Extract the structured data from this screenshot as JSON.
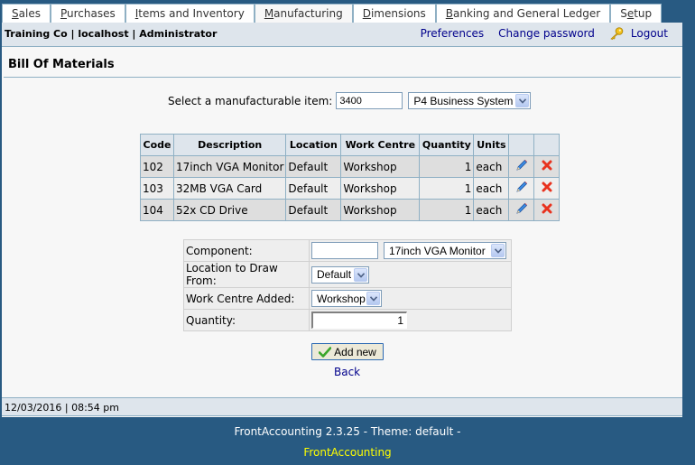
{
  "tabs": [
    {
      "pre": "",
      "u": "S",
      "post": "ales"
    },
    {
      "pre": "",
      "u": "P",
      "post": "urchases"
    },
    {
      "pre": "",
      "u": "I",
      "post": "tems and Inventory"
    },
    {
      "pre": "",
      "u": "M",
      "post": "anufacturing"
    },
    {
      "pre": "",
      "u": "D",
      "post": "imensions"
    },
    {
      "pre": "",
      "u": "B",
      "post": "anking and General Ledger"
    },
    {
      "pre": "S",
      "u": "e",
      "post": "tup"
    }
  ],
  "active_tab": "Manufacturing",
  "header": {
    "company": "Training Co | localhost | Administrator",
    "preferences": "Preferences",
    "change_password": "Change password",
    "logout": "Logout"
  },
  "page_title": "Bill Of Materials",
  "selector": {
    "label": "Select a manufacturable item:",
    "code_value": "3400",
    "item_selected": "P4 Business System"
  },
  "bom_table": {
    "headers": [
      "Code",
      "Description",
      "Location",
      "Work Centre",
      "Quantity",
      "Units",
      "",
      ""
    ],
    "rows": [
      {
        "code": "102",
        "description": "17inch VGA Monitor",
        "location": "Default",
        "work_centre": "Workshop",
        "quantity": "1",
        "units": "each"
      },
      {
        "code": "103",
        "description": "32MB VGA Card",
        "location": "Default",
        "work_centre": "Workshop",
        "quantity": "1",
        "units": "each"
      },
      {
        "code": "104",
        "description": "52x CD Drive",
        "location": "Default",
        "work_centre": "Workshop",
        "quantity": "1",
        "units": "each"
      }
    ]
  },
  "form": {
    "component_label": "Component:",
    "component_code": "",
    "component_selected": "17inch VGA Monitor",
    "location_label": "Location to Draw From:",
    "location_selected": "Default",
    "work_centre_label": "Work Centre Added:",
    "work_centre_selected": "Workshop",
    "quantity_label": "Quantity:",
    "quantity_value": "1"
  },
  "buttons": {
    "add_new": "Add new",
    "back": "Back"
  },
  "status": {
    "datetime": "12/03/2016 | 08:54 pm"
  },
  "footer": {
    "version": "FrontAccounting 2.3.25 - Theme: default -",
    "link": "FrontAccounting"
  }
}
